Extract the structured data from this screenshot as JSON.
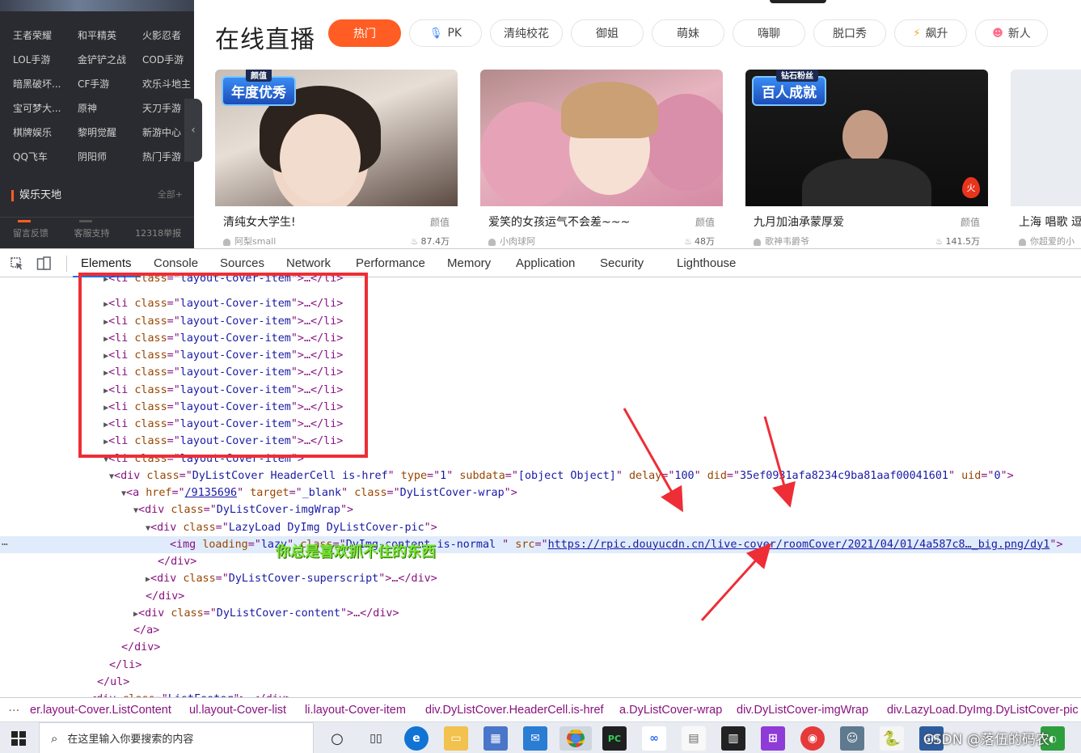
{
  "sidebar": {
    "games": [
      [
        "王者荣耀",
        "和平精英",
        "火影忍者"
      ],
      [
        "LOL手游",
        "金铲铲之战",
        "COD手游"
      ],
      [
        "暗黑破坏...",
        "CF手游",
        "欢乐斗地主"
      ],
      [
        "宝可梦大...",
        "原神",
        "天刀手游"
      ],
      [
        "棋牌娱乐",
        "黎明觉醒",
        "新游中心"
      ],
      [
        "QQ飞车",
        "阴阳师",
        "热门手游"
      ]
    ],
    "section_title": "娱乐天地",
    "section_more": "全部+",
    "collapse_glyph": "‹",
    "footer": [
      "留言反馈",
      "客服支持",
      "12318举报"
    ]
  },
  "header": {
    "title": "在线直播",
    "categories": [
      {
        "label": "热门",
        "icon": "",
        "active": true
      },
      {
        "label": "PK",
        "icon": "mic-icon"
      },
      {
        "label": "清纯校花",
        "icon": ""
      },
      {
        "label": "御姐",
        "icon": ""
      },
      {
        "label": "萌妹",
        "icon": ""
      },
      {
        "label": "嗨聊",
        "icon": ""
      },
      {
        "label": "脱口秀",
        "icon": ""
      },
      {
        "label": "飙升",
        "icon": "bolt-icon"
      },
      {
        "label": "新人",
        "icon": "new-icon"
      }
    ]
  },
  "cards": [
    {
      "title": "清纯女大学生!",
      "tag": "颜值",
      "anchor": "阿梨small",
      "heat": "87.4万",
      "badge": "年度优秀",
      "badge_sub": "颜值"
    },
    {
      "title": "爱笑的女孩运气不会差~~~",
      "tag": "颜值",
      "anchor": "小肉球阿",
      "heat": "48万"
    },
    {
      "title": "九月加油承蒙厚爱",
      "tag": "颜值",
      "anchor": "歌神韦爵爷",
      "heat": "141.5万",
      "badge": "百人成就",
      "badge_sub": "钻石粉丝",
      "hot_mark": "火"
    },
    {
      "title": "上海 唱歌 逗",
      "tag": "",
      "anchor": "你超爱的小",
      "heat": ""
    }
  ],
  "devtools": {
    "tabs": [
      "Elements",
      "Console",
      "Sources",
      "Network",
      "Performance",
      "Memory",
      "Application",
      "Security",
      "Lighthouse"
    ],
    "active_tab": "Elements",
    "breadcrumbs": [
      "er.layout-Cover.ListContent",
      "ul.layout-Cover-list",
      "li.layout-Cover-item",
      "div.DyListCover.HeaderCell.is-href",
      "a.DyListCover-wrap",
      "div.DyListCover-imgWrap",
      "div.LazyLoad.DyImg.DyListCover-pic"
    ],
    "breadcrumbs_more": "…",
    "code": {
      "li_tag": "li",
      "li_class": "layout-Cover-item",
      "cover_div_class": "DyListCover HeaderCell is-href",
      "type": "1",
      "subdata": "[object Object]",
      "delay": "100",
      "did": "35ef0931afa8234c9ba81aaf00041601",
      "uid": "0",
      "href": "/9135696",
      "target": "_blank",
      "wrap_class": "DyListCover-wrap",
      "imgwrap_class": "DyListCover-imgWrap",
      "pic_class": "LazyLoad DyImg DyListCover-pic",
      "img_loading": "lazy",
      "img_class": "DyImg-content is-normal ",
      "img_src": "https://rpic.douyucdn.cn/live-cover/roomCover/2021/04/01/4a587c8…_big.png/dy1",
      "superscript_class": "DyListCover-superscript",
      "content_class": "DyListCover-content",
      "footer_class": "ListFooter"
    }
  },
  "annotation_text": "你总是喜欢抓不住的东西",
  "taskbar": {
    "search_placeholder": "在这里输入你要搜索的内容",
    "watermark": "CSDN @落伍的码农"
  },
  "colors": {
    "accent": "#ff5d23",
    "annotation_red": "#ee2d36",
    "tag_purple": "#881280",
    "attr_brown": "#994500",
    "value_blue": "#1a1aa6"
  }
}
